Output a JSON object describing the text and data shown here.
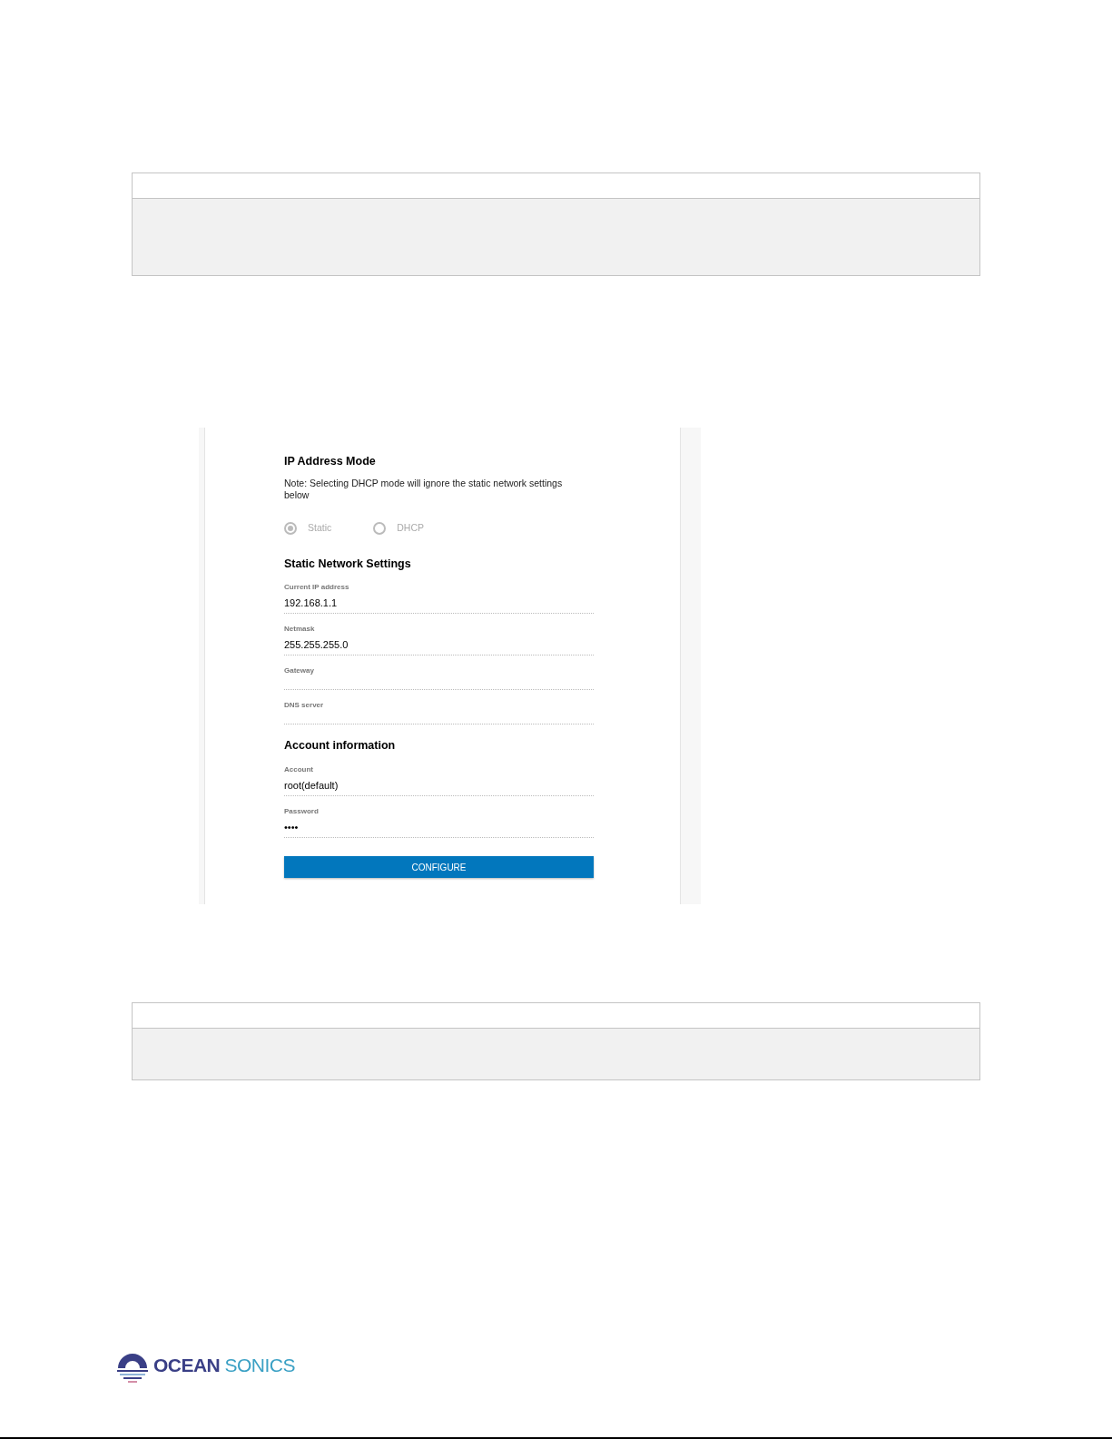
{
  "ip_mode": {
    "title": "IP Address Mode",
    "note": "Note: Selecting DHCP mode will ignore the static network settings below",
    "disabled": true,
    "options": [
      {
        "label": "Static",
        "selected": true
      },
      {
        "label": "DHCP",
        "selected": false
      }
    ]
  },
  "static_settings": {
    "title": "Static Network Settings",
    "fields": [
      {
        "label": "Current IP address",
        "value": "192.168.1.1"
      },
      {
        "label": "Netmask",
        "value": "255.255.255.0"
      },
      {
        "label": "Gateway"
      },
      {
        "label": "DNS server"
      }
    ]
  },
  "account": {
    "title": "Account information",
    "fields": [
      {
        "label": "Account",
        "value": "root(default)"
      },
      {
        "label": "Password",
        "value": "••••"
      }
    ]
  },
  "configure_button": "CONFIGURE",
  "logo": {
    "word_1": "OCEAN",
    "word_2": "SONICS"
  }
}
